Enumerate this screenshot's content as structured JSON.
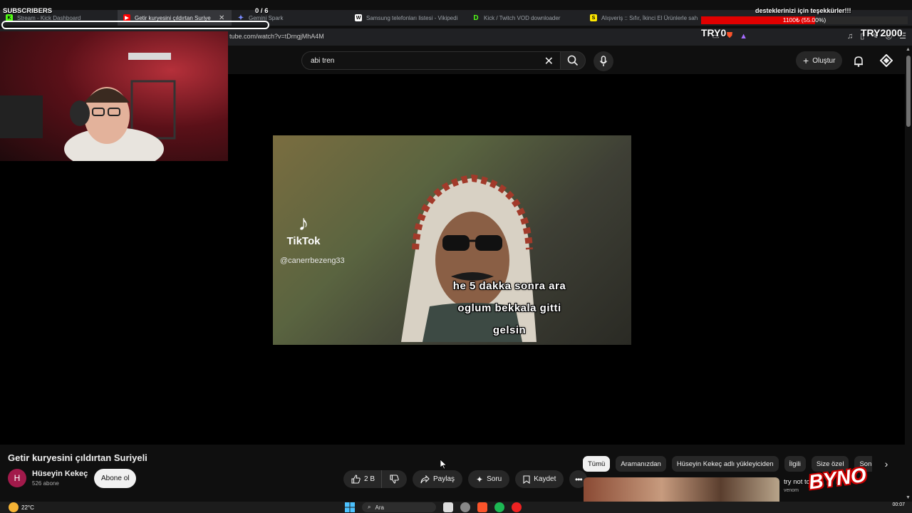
{
  "browser": {
    "tabs": [
      {
        "label": "Stream - Kick Dashboard",
        "icon": "kick-icon",
        "color": "#53fc18",
        "active": false
      },
      {
        "label": "Getir kuryesini çıldırtan Suriye",
        "icon": "youtube-icon",
        "color": "#ff0000",
        "active": true
      },
      {
        "label": "Gemini Spark",
        "icon": "gemini-icon",
        "color": "#7a8cff",
        "active": false
      },
      {
        "label": "Samsung telefonları listesi - Vikipedi",
        "icon": "wikipedia-icon",
        "color": "#ffffff",
        "active": false
      },
      {
        "label": "Kick / Twitch VOD downloader",
        "icon": "downloader-icon",
        "color": "#53fc18",
        "active": false
      },
      {
        "label": "Alışveriş :: Sıfır, İkinci El Ürünlerle sah",
        "icon": "sahibinden-icon",
        "color": "#ffe800",
        "active": false
      }
    ],
    "url": "tube.com/watch?v=tDrngjMhA4M"
  },
  "youtube": {
    "search_query": "abi tren",
    "create_label": "Oluştur",
    "video": {
      "tiktok_label": "TikTok",
      "tiktok_user": "@canerrbezeng33",
      "subtitle_lines": [
        "he 5 dakka sonra ara",
        "oglum bekkala gitti",
        "gelsin"
      ]
    },
    "title": "Getir kuryesini çıldırtan Suriyeli",
    "channel": {
      "initial": "H",
      "name": "Hüseyin Kekeç",
      "subscribers": "526 abone",
      "subscribe_label": "Abone ol"
    },
    "actions": {
      "likes": "2 B",
      "share": "Paylaş",
      "ask": "Soru",
      "save": "Kaydet"
    },
    "chips": [
      "Tümü",
      "Aramanızdan",
      "Hüseyin Kekeç adlı yükleyiciden",
      "İlgili",
      "Size özel",
      "Son"
    ],
    "recommendation": {
      "title": "try not to",
      "channel": "venom"
    }
  },
  "taskbar": {
    "temperature": "22°C",
    "search_placeholder": "Ara",
    "time": "00:07"
  },
  "overlay": {
    "subscribers_label": "SUBSCRIBERS",
    "subscriber_count": "0 / 6",
    "donation_title": "desteklerinizi için teşekkürler!!!",
    "donation_progress_text": "1100₺ (55.00%)",
    "donation_progress_fraction": 0.55,
    "goal_min": "TRY0",
    "goal_max": "TRY2000",
    "logo_text": "BYNO",
    "donation_color": "#e00000"
  }
}
